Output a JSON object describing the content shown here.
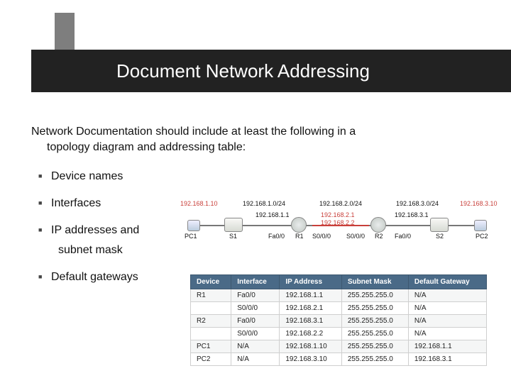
{
  "title": "Document Network Addressing",
  "intro_line1": "Network Documentation should include at least the following in a",
  "intro_line2": "topology diagram and addressing table:",
  "bullets": [
    "Device names",
    "Interfaces",
    "IP addresses and",
    "Default gateways"
  ],
  "bullet_sub": "subnet mask",
  "topology": {
    "pc1_ip": "192.168.1.10",
    "pc2_ip": "192.168.3.10",
    "net1": "192.168.1.0/24",
    "net2": "192.168.2.0/24",
    "net3": "192.168.3.0/24",
    "s1": "S1",
    "s2": "S2",
    "r1": "R1",
    "r2": "R2",
    "pc1": "PC1",
    "pc2": "PC2",
    "lan1": "192.168.1.1",
    "wan1": "192.168.2.1",
    "wan2": "192.168.2.2",
    "lan2": "192.168.3.1",
    "fa00a": "Fa0/0",
    "fa00b": "Fa0/0",
    "s000a": "S0/0/0",
    "s000b": "S0/0/0"
  },
  "table_headers": [
    "Device",
    "Interface",
    "IP Address",
    "Subnet Mask",
    "Default Gateway"
  ],
  "table_rows": [
    [
      "R1",
      "Fa0/0",
      "192.168.1.1",
      "255.255.255.0",
      "N/A"
    ],
    [
      "",
      "S0/0/0",
      "192.168.2.1",
      "255.255.255.0",
      "N/A"
    ],
    [
      "R2",
      "Fa0/0",
      "192.168.3.1",
      "255.255.255.0",
      "N/A"
    ],
    [
      "",
      "S0/0/0",
      "192.168.2.2",
      "255.255.255.0",
      "N/A"
    ],
    [
      "PC1",
      "N/A",
      "192.168.1.10",
      "255.255.255.0",
      "192.168.1.1"
    ],
    [
      "PC2",
      "N/A",
      "192.168.3.10",
      "255.255.255.0",
      "192.168.3.1"
    ]
  ]
}
